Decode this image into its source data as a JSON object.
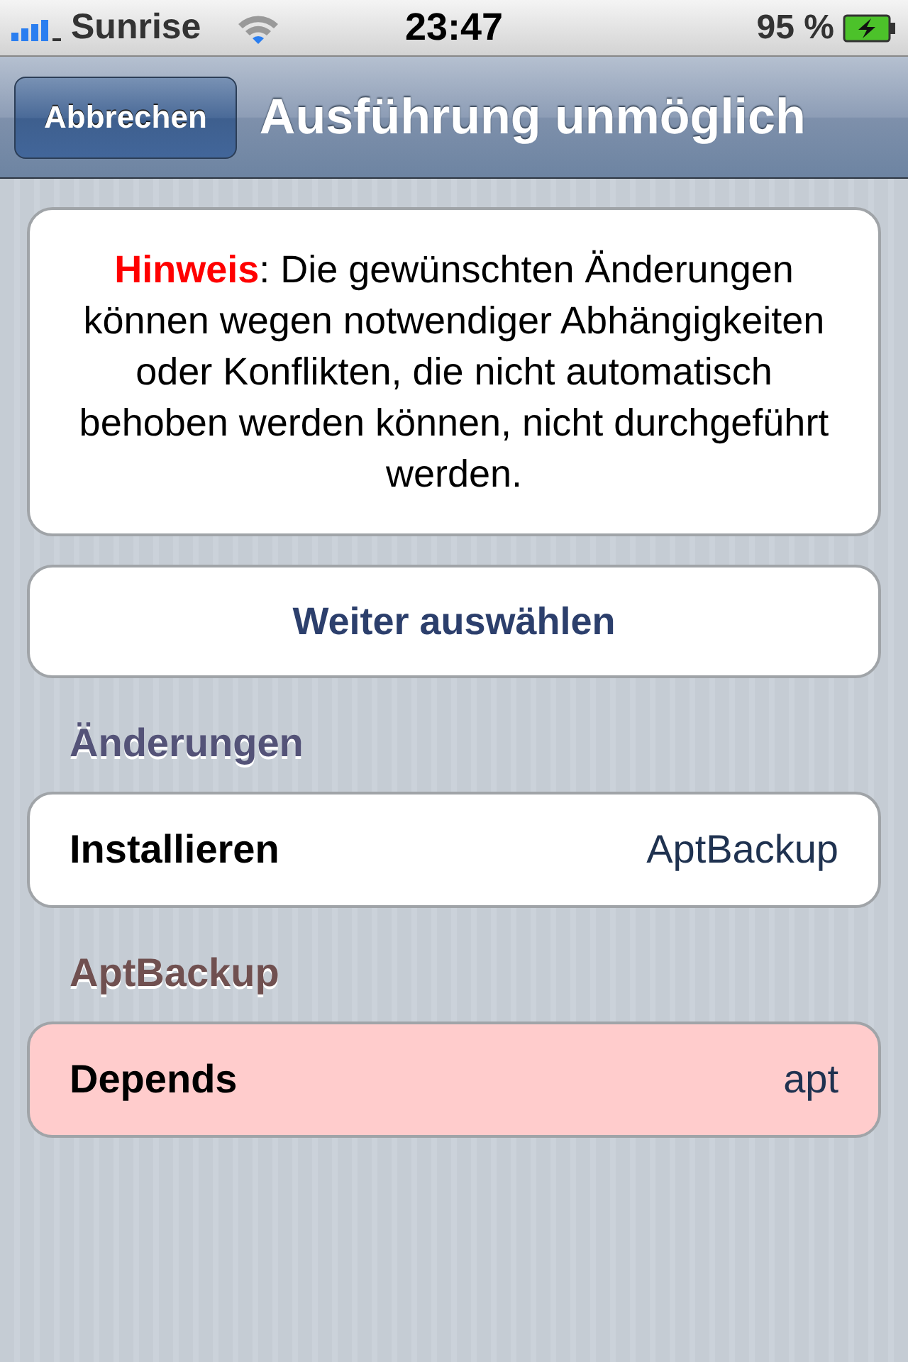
{
  "status_bar": {
    "carrier": "Sunrise",
    "time": "23:47",
    "battery": "95 %"
  },
  "nav_bar": {
    "back_button": "Abbrechen",
    "title": "Ausführung unmöglich"
  },
  "notice": {
    "label": "Hinweis",
    "text": ": Die gewünschten Änderungen können wegen notwendiger Abhängigkeiten oder Konflikten, die nicht automatisch behoben werden können, nicht durchgeführt werden."
  },
  "action_button": "Weiter auswählen",
  "sections": [
    {
      "title": "Änderungen",
      "color": "#545378",
      "rows": [
        {
          "label": "Installieren",
          "value": "AptBackup",
          "color": "#ffffff"
        }
      ]
    },
    {
      "title": "AptBackup",
      "color": "#705050",
      "rows": [
        {
          "label": "Depends",
          "value": "apt",
          "color": "#ffcccc"
        }
      ]
    }
  ]
}
